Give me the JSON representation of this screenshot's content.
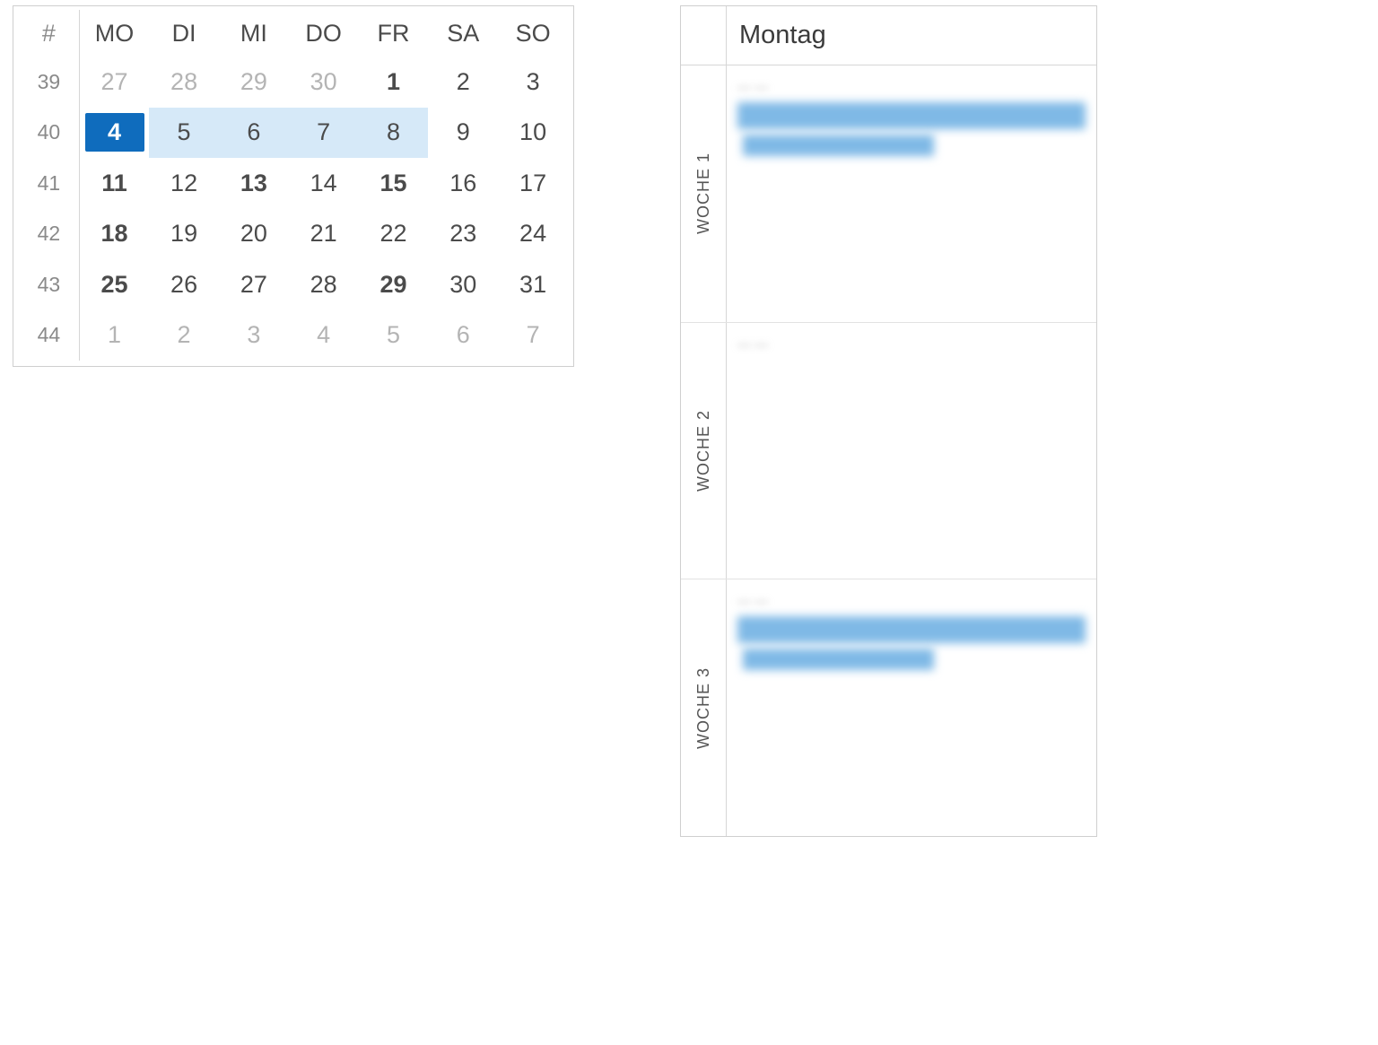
{
  "calendar": {
    "weekHeader": "#",
    "dayHeaders": [
      "MO",
      "DI",
      "MI",
      "DO",
      "FR",
      "SA",
      "SO"
    ],
    "rows": [
      {
        "week": 39,
        "days": [
          {
            "n": 27,
            "out": true
          },
          {
            "n": 28,
            "out": true
          },
          {
            "n": 29,
            "out": true
          },
          {
            "n": 30,
            "out": true
          },
          {
            "n": 1,
            "bold": true
          },
          {
            "n": 2
          },
          {
            "n": 3
          }
        ]
      },
      {
        "week": 40,
        "days": [
          {
            "n": 4,
            "today": true,
            "bold": true,
            "sel": true
          },
          {
            "n": 5,
            "sel": true
          },
          {
            "n": 6,
            "sel": true
          },
          {
            "n": 7,
            "sel": true
          },
          {
            "n": 8,
            "sel": true
          },
          {
            "n": 9
          },
          {
            "n": 10
          }
        ]
      },
      {
        "week": 41,
        "days": [
          {
            "n": 11,
            "bold": true
          },
          {
            "n": 12
          },
          {
            "n": 13,
            "bold": true
          },
          {
            "n": 14
          },
          {
            "n": 15,
            "bold": true
          },
          {
            "n": 16
          },
          {
            "n": 17
          }
        ]
      },
      {
        "week": 42,
        "days": [
          {
            "n": 18,
            "bold": true
          },
          {
            "n": 19
          },
          {
            "n": 20
          },
          {
            "n": 21
          },
          {
            "n": 22
          },
          {
            "n": 23
          },
          {
            "n": 24
          }
        ]
      },
      {
        "week": 43,
        "days": [
          {
            "n": 25,
            "bold": true
          },
          {
            "n": 26
          },
          {
            "n": 27
          },
          {
            "n": 28
          },
          {
            "n": 29,
            "bold": true
          },
          {
            "n": 30
          },
          {
            "n": 31
          }
        ]
      },
      {
        "week": 44,
        "days": [
          {
            "n": 1,
            "out": true
          },
          {
            "n": 2,
            "out": true
          },
          {
            "n": 3,
            "out": true
          },
          {
            "n": 4,
            "out": true
          },
          {
            "n": 5,
            "out": true
          },
          {
            "n": 6,
            "out": true
          },
          {
            "n": 7,
            "out": true
          }
        ]
      }
    ]
  },
  "schedule": {
    "dayTitle": "Montag",
    "weeks": [
      {
        "label": "WOCHE 1",
        "hasEvents": true
      },
      {
        "label": "WOCHE 2",
        "hasEvents": false
      },
      {
        "label": "WOCHE 3",
        "hasEvents": true
      }
    ]
  }
}
